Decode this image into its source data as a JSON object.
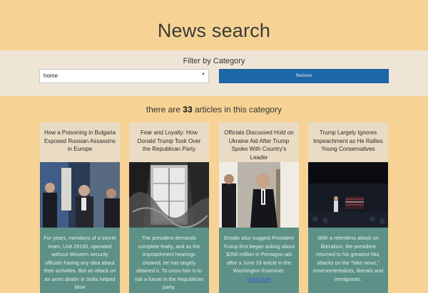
{
  "header": {
    "title": "News search"
  },
  "filter": {
    "label": "Filter by Category",
    "selected_category": "home",
    "button_label": "Retrieve"
  },
  "results": {
    "count_prefix": "there are",
    "count": "33",
    "count_suffix": "articles in this category"
  },
  "articles": [
    {
      "title": "How a Poisoning in Bulgaria Exposed Russian Assassins in Europe",
      "summary": "For years, members of a secret team, Unit 29155, operated without Western security officials having any idea about their activities. But an attack on an arms dealer in Sofia helped blow"
    },
    {
      "title": "Fear and Loyalty: How Donald Trump Took Over the Republican Party",
      "summary": "The president demands complete fealty, and as the impeachment hearings showed, he has largely attained it. To cross him is to risk a future in the Republican party."
    },
    {
      "title": "Officials Discussed Hold on Ukraine Aid After Trump Spoke With Country’s Leader",
      "summary": "Emails also suggest President Trump first began asking about $250 million in Pentagon aid after a June 19 article in the Washington Examiner.",
      "link": "read more"
    },
    {
      "title": "Trump Largely Ignores Impeachment as He Rallies Young Conservatives",
      "summary": "With a relentless attack on liberalism, the president returned to his greatest hits, attacks on the “fake news,” environmentalists, liberals and immigrants."
    }
  ],
  "colors": {
    "background": "#f6d394",
    "filter_band": "#efe5d6",
    "button": "#1d67a8",
    "card_top": "#eadbc4",
    "card_summary": "#5d9187"
  }
}
